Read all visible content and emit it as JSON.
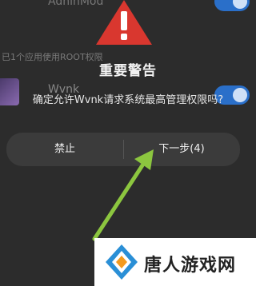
{
  "background": {
    "top_item_label": "AdhinMod",
    "root_info": "已1个应用使用ROOT权限",
    "app_label": "Wvnk"
  },
  "dialog": {
    "title": "重要警告",
    "message": "确定允许Wvnk请求系统最高管理权限吗?",
    "buttons": {
      "forbid": "禁止",
      "next": "下一步(4)"
    }
  },
  "watermark": {
    "text": "唐人游戏网"
  },
  "colors": {
    "warning_red": "#d9372f",
    "arrow_green": "#8cc63f",
    "toggle_blue": "#2a6fc9"
  }
}
